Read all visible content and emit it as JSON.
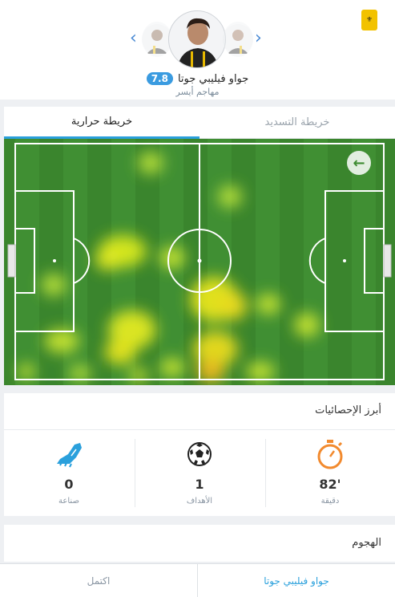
{
  "header": {
    "club_logo_icon": "ittihad-logo-icon",
    "player_name": "جواو فيليبي جوتا",
    "rating": "7.8",
    "position": "مهاجم أيسر",
    "prev_arrow": "‹",
    "next_arrow": "›"
  },
  "tabs": [
    {
      "label": "خريطة حرارية",
      "active": true
    },
    {
      "label": "خريطة التسديد",
      "active": false
    }
  ],
  "heatmap": {
    "back_icon": "arrow-left-icon",
    "accent": "#3d8b30"
  },
  "stats": {
    "title": "أبرز الإحصائيات",
    "items": [
      {
        "icon": "stopwatch-icon",
        "value": "82'",
        "label": "دقيقة",
        "color": "#f28a2e"
      },
      {
        "icon": "soccer-ball-icon",
        "value": "1",
        "label": "الأهداف",
        "color": "#222222"
      },
      {
        "icon": "football-boot-icon",
        "value": "0",
        "label": "صناعة",
        "color": "#2aa0dc"
      }
    ]
  },
  "attack": {
    "title": "الهجوم"
  },
  "bottom_tabs": [
    {
      "label": "جواو فيليبي جوتا",
      "active": true
    },
    {
      "label": "اكتمل",
      "active": false
    }
  ]
}
